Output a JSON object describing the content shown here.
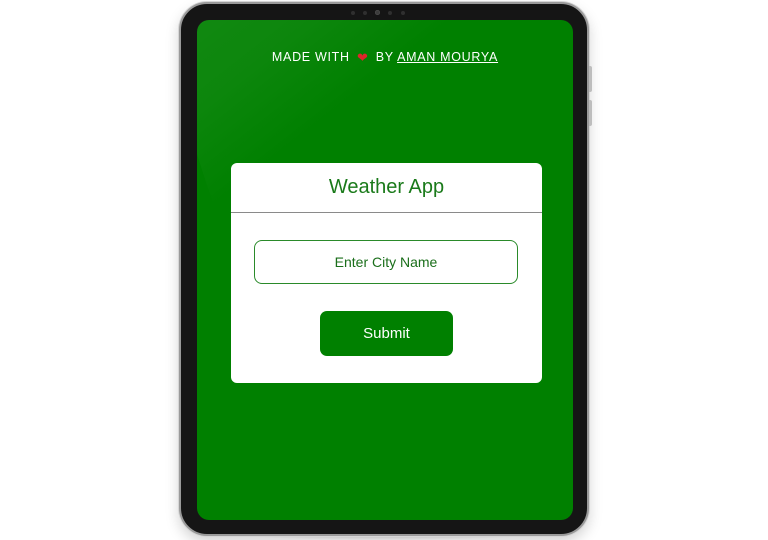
{
  "credit": {
    "prefix": "MADE WITH",
    "heart_icon": "heart-icon",
    "by": "BY",
    "author_link": "AMAN MOURYA"
  },
  "card": {
    "title": "Weather App",
    "city_input_placeholder": "Enter City Name",
    "submit_label": "Submit"
  },
  "colors": {
    "app_background": "#008000",
    "accent_green": "#1a7a1a",
    "heart": "#e0242a",
    "card_background": "#ffffff"
  }
}
